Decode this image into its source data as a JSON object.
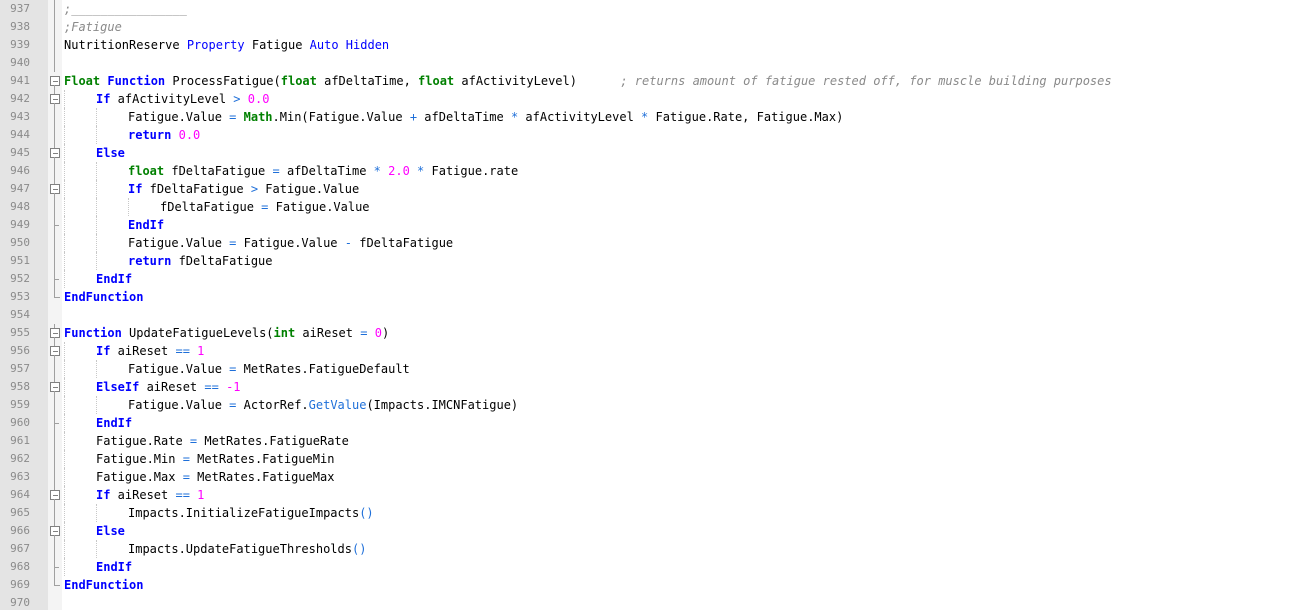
{
  "editor": {
    "lines": [
      {
        "n": "937",
        "fold": "line",
        "indent": 0,
        "tokens": [
          {
            "t": ";________________",
            "c": "cm"
          }
        ]
      },
      {
        "n": "938",
        "fold": "line",
        "indent": 0,
        "tokens": [
          {
            "t": ";Fatigue",
            "c": "cm"
          }
        ]
      },
      {
        "n": "939",
        "fold": "line",
        "indent": 0,
        "tokens": [
          {
            "t": "NutritionReserve ",
            "c": ""
          },
          {
            "t": "Property",
            "c": "pr"
          },
          {
            "t": " Fatigue ",
            "c": ""
          },
          {
            "t": "Auto",
            "c": "pr"
          },
          {
            "t": " ",
            "c": ""
          },
          {
            "t": "Hidden",
            "c": "pr"
          }
        ]
      },
      {
        "n": "940",
        "fold": "line",
        "indent": 0,
        "tokens": []
      },
      {
        "n": "941",
        "fold": "open",
        "indent": 0,
        "tokens": [
          {
            "t": "Float",
            "c": "ty"
          },
          {
            "t": " ",
            "c": ""
          },
          {
            "t": "Function",
            "c": "kw"
          },
          {
            "t": " ProcessFatigue(",
            "c": ""
          },
          {
            "t": "float",
            "c": "ty"
          },
          {
            "t": " afDeltaTime, ",
            "c": ""
          },
          {
            "t": "float",
            "c": "ty"
          },
          {
            "t": " afActivityLevel)      ",
            "c": ""
          },
          {
            "t": "; returns amount of fatigue rested off, for muscle building purposes",
            "c": "cm"
          }
        ]
      },
      {
        "n": "942",
        "fold": "open",
        "indent": 1,
        "tokens": [
          {
            "t": "If",
            "c": "kw"
          },
          {
            "t": " afActivityLevel ",
            "c": ""
          },
          {
            "t": ">",
            "c": "op"
          },
          {
            "t": " ",
            "c": ""
          },
          {
            "t": "0.0",
            "c": "num"
          }
        ]
      },
      {
        "n": "943",
        "fold": "line",
        "indent": 2,
        "tokens": [
          {
            "t": "Fatigue.Value ",
            "c": ""
          },
          {
            "t": "=",
            "c": "op"
          },
          {
            "t": " ",
            "c": ""
          },
          {
            "t": "Math",
            "c": "ty"
          },
          {
            "t": ".Min(Fatigue.Value ",
            "c": ""
          },
          {
            "t": "+",
            "c": "op"
          },
          {
            "t": " afDeltaTime ",
            "c": ""
          },
          {
            "t": "*",
            "c": "op"
          },
          {
            "t": " afActivityLevel ",
            "c": ""
          },
          {
            "t": "*",
            "c": "op"
          },
          {
            "t": " Fatigue.Rate, Fatigue.Max)",
            "c": ""
          }
        ]
      },
      {
        "n": "944",
        "fold": "line",
        "indent": 2,
        "tokens": [
          {
            "t": "return",
            "c": "kw"
          },
          {
            "t": " ",
            "c": ""
          },
          {
            "t": "0.0",
            "c": "num"
          }
        ]
      },
      {
        "n": "945",
        "fold": "open",
        "indent": 1,
        "tokens": [
          {
            "t": "Else",
            "c": "kw"
          }
        ]
      },
      {
        "n": "946",
        "fold": "line",
        "indent": 2,
        "tokens": [
          {
            "t": "float",
            "c": "ty"
          },
          {
            "t": " fDeltaFatigue ",
            "c": ""
          },
          {
            "t": "=",
            "c": "op"
          },
          {
            "t": " afDeltaTime ",
            "c": ""
          },
          {
            "t": "*",
            "c": "op"
          },
          {
            "t": " ",
            "c": ""
          },
          {
            "t": "2.0",
            "c": "num"
          },
          {
            "t": " ",
            "c": ""
          },
          {
            "t": "*",
            "c": "op"
          },
          {
            "t": " Fatigue.rate",
            "c": ""
          }
        ]
      },
      {
        "n": "947",
        "fold": "open",
        "indent": 2,
        "tokens": [
          {
            "t": "If",
            "c": "kw"
          },
          {
            "t": " fDeltaFatigue ",
            "c": ""
          },
          {
            "t": ">",
            "c": "op"
          },
          {
            "t": " Fatigue.Value",
            "c": ""
          }
        ]
      },
      {
        "n": "948",
        "fold": "line",
        "indent": 3,
        "tokens": [
          {
            "t": "fDeltaFatigue ",
            "c": ""
          },
          {
            "t": "=",
            "c": "op"
          },
          {
            "t": " Fatigue.Value",
            "c": ""
          }
        ]
      },
      {
        "n": "949",
        "fold": "tick",
        "indent": 2,
        "tokens": [
          {
            "t": "EndIf",
            "c": "kw"
          }
        ]
      },
      {
        "n": "950",
        "fold": "line",
        "indent": 2,
        "tokens": [
          {
            "t": "Fatigue.Value ",
            "c": ""
          },
          {
            "t": "=",
            "c": "op"
          },
          {
            "t": " Fatigue.Value ",
            "c": ""
          },
          {
            "t": "-",
            "c": "op"
          },
          {
            "t": " fDeltaFatigue",
            "c": ""
          }
        ]
      },
      {
        "n": "951",
        "fold": "line",
        "indent": 2,
        "tokens": [
          {
            "t": "return",
            "c": "kw"
          },
          {
            "t": " fDeltaFatigue",
            "c": ""
          }
        ]
      },
      {
        "n": "952",
        "fold": "tick",
        "indent": 1,
        "tokens": [
          {
            "t": "EndIf",
            "c": "kw"
          }
        ]
      },
      {
        "n": "953",
        "fold": "end",
        "indent": 0,
        "tokens": [
          {
            "t": "EndFunction",
            "c": "kw"
          }
        ]
      },
      {
        "n": "954",
        "fold": "none",
        "indent": 0,
        "tokens": []
      },
      {
        "n": "955",
        "fold": "open",
        "indent": 0,
        "tokens": [
          {
            "t": "Function",
            "c": "kw"
          },
          {
            "t": " UpdateFatigueLevels(",
            "c": ""
          },
          {
            "t": "int",
            "c": "ty"
          },
          {
            "t": " aiReset ",
            "c": ""
          },
          {
            "t": "=",
            "c": "op"
          },
          {
            "t": " ",
            "c": ""
          },
          {
            "t": "0",
            "c": "num"
          },
          {
            "t": ")",
            "c": ""
          }
        ]
      },
      {
        "n": "956",
        "fold": "open",
        "indent": 1,
        "tokens": [
          {
            "t": "If",
            "c": "kw"
          },
          {
            "t": " aiReset ",
            "c": ""
          },
          {
            "t": "==",
            "c": "op"
          },
          {
            "t": " ",
            "c": ""
          },
          {
            "t": "1",
            "c": "num"
          }
        ]
      },
      {
        "n": "957",
        "fold": "line",
        "indent": 2,
        "tokens": [
          {
            "t": "Fatigue.Value ",
            "c": ""
          },
          {
            "t": "=",
            "c": "op"
          },
          {
            "t": " MetRates.FatigueDefault",
            "c": ""
          }
        ]
      },
      {
        "n": "958",
        "fold": "open",
        "indent": 1,
        "tokens": [
          {
            "t": "ElseIf",
            "c": "kw"
          },
          {
            "t": " aiReset ",
            "c": ""
          },
          {
            "t": "==",
            "c": "op"
          },
          {
            "t": " ",
            "c": ""
          },
          {
            "t": "-1",
            "c": "num"
          }
        ]
      },
      {
        "n": "959",
        "fold": "line",
        "indent": 2,
        "tokens": [
          {
            "t": "Fatigue.Value ",
            "c": ""
          },
          {
            "t": "=",
            "c": "op"
          },
          {
            "t": " ActorRef.",
            "c": ""
          },
          {
            "t": "GetValue",
            "c": "fn"
          },
          {
            "t": "(Impacts.IMCNFatigue)",
            "c": ""
          }
        ]
      },
      {
        "n": "960",
        "fold": "tick",
        "indent": 1,
        "tokens": [
          {
            "t": "EndIf",
            "c": "kw"
          }
        ]
      },
      {
        "n": "961",
        "fold": "line",
        "indent": 1,
        "tokens": [
          {
            "t": "Fatigue.Rate ",
            "c": ""
          },
          {
            "t": "=",
            "c": "op"
          },
          {
            "t": " MetRates.FatigueRate",
            "c": ""
          }
        ]
      },
      {
        "n": "962",
        "fold": "line",
        "indent": 1,
        "tokens": [
          {
            "t": "Fatigue.Min ",
            "c": ""
          },
          {
            "t": "=",
            "c": "op"
          },
          {
            "t": " MetRates.FatigueMin",
            "c": ""
          }
        ]
      },
      {
        "n": "963",
        "fold": "line",
        "indent": 1,
        "tokens": [
          {
            "t": "Fatigue.Max ",
            "c": ""
          },
          {
            "t": "=",
            "c": "op"
          },
          {
            "t": " MetRates.FatigueMax",
            "c": ""
          }
        ]
      },
      {
        "n": "964",
        "fold": "open",
        "indent": 1,
        "tokens": [
          {
            "t": "If",
            "c": "kw"
          },
          {
            "t": " aiReset ",
            "c": ""
          },
          {
            "t": "==",
            "c": "op"
          },
          {
            "t": " ",
            "c": ""
          },
          {
            "t": "1",
            "c": "num"
          }
        ]
      },
      {
        "n": "965",
        "fold": "line",
        "indent": 2,
        "tokens": [
          {
            "t": "Impacts.InitializeFatigueImpacts",
            "c": ""
          },
          {
            "t": "()",
            "c": "op"
          }
        ]
      },
      {
        "n": "966",
        "fold": "open",
        "indent": 1,
        "tokens": [
          {
            "t": "Else",
            "c": "kw"
          }
        ]
      },
      {
        "n": "967",
        "fold": "line",
        "indent": 2,
        "tokens": [
          {
            "t": "Impacts.UpdateFatigueThresholds",
            "c": ""
          },
          {
            "t": "()",
            "c": "op"
          }
        ]
      },
      {
        "n": "968",
        "fold": "tick",
        "indent": 1,
        "tokens": [
          {
            "t": "EndIf",
            "c": "kw"
          }
        ]
      },
      {
        "n": "969",
        "fold": "end",
        "indent": 0,
        "tokens": [
          {
            "t": "EndFunction",
            "c": "kw"
          }
        ]
      },
      {
        "n": "970",
        "fold": "none",
        "indent": 0,
        "tokens": []
      }
    ]
  }
}
